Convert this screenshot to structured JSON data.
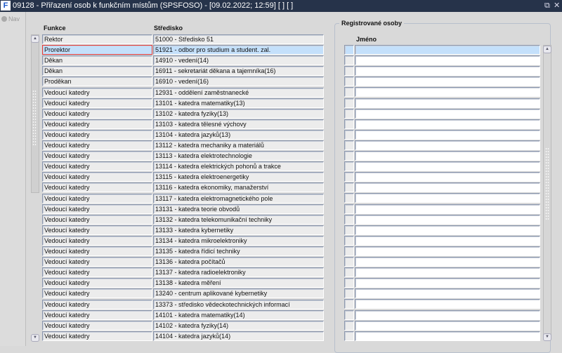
{
  "window": {
    "title": "09128 - Přiřazení osob k funkčním místům (SPSFOSO) - [09.02.2022; 12:59]  [ ]  [ ]",
    "logo": "F",
    "restore_icon": "⧉",
    "close_icon": "✕"
  },
  "nav": {
    "label": "Nav"
  },
  "left_table": {
    "headers": {
      "funkce": "Funkce",
      "stredisko": "Středisko"
    },
    "selected_index": 1,
    "rows": [
      [
        "Rektor",
        "51000 - Středisko 51"
      ],
      [
        "Prorektor",
        "51921 - odbor pro studium a student. zal."
      ],
      [
        "Děkan",
        "14910 - vedení(14)"
      ],
      [
        "Děkan",
        "16911 - sekretariát děkana a tajemníka(16)"
      ],
      [
        "Proděkan",
        "16910 - vedení(16)"
      ],
      [
        "Vedoucí katedry",
        "12931 - oddělení zaměstnanecké"
      ],
      [
        "Vedoucí katedry",
        "13101 - katedra matematiky(13)"
      ],
      [
        "Vedoucí katedry",
        "13102 - katedra fyziky(13)"
      ],
      [
        "Vedoucí katedry",
        "13103 - katedra tělesné výchovy"
      ],
      [
        "Vedoucí katedry",
        "13104 - katedra jazyků(13)"
      ],
      [
        "Vedoucí katedry",
        "13112 - katedra mechaniky a materiálů"
      ],
      [
        "Vedoucí katedry",
        "13113 - katedra elektrotechnologie"
      ],
      [
        "Vedoucí katedry",
        "13114 - katedra elektrických pohonů a trakce"
      ],
      [
        "Vedoucí katedry",
        "13115 - katedra elektroenergetiky"
      ],
      [
        "Vedoucí katedry",
        "13116 - katedra ekonomiky, manažerství"
      ],
      [
        "Vedoucí katedry",
        "13117 - katedra elektromagnetického pole"
      ],
      [
        "Vedoucí katedry",
        "13131 - katedra teorie obvodů"
      ],
      [
        "Vedoucí katedry",
        "13132 - katedra telekomunikační techniky"
      ],
      [
        "Vedoucí katedry",
        "13133 - katedra kybernetiky"
      ],
      [
        "Vedoucí katedry",
        "13134 - katedra mikroelektroniky"
      ],
      [
        "Vedoucí katedry",
        "13135 - katedra řídicí techniky"
      ],
      [
        "Vedoucí katedry",
        "13136 - katedra počítačů"
      ],
      [
        "Vedoucí katedry",
        "13137 - katedra radioelektroniky"
      ],
      [
        "Vedoucí katedry",
        "13138 - katedra měření"
      ],
      [
        "Vedoucí katedry",
        "13240 - centrum aplikované kybernetiky"
      ],
      [
        "Vedoucí katedry",
        "13373 - středisko vědeckotechnických informací"
      ],
      [
        "Vedoucí katedry",
        "14101 - katedra matematiky(14)"
      ],
      [
        "Vedoucí katedry",
        "14102 - katedra fyziky(14)"
      ],
      [
        "Vedoucí katedry",
        "14104 - katedra jazyků(14)"
      ]
    ]
  },
  "registered": {
    "legend": "Registrované osoby",
    "header": "Jméno",
    "row_count": 28,
    "selected_index": 0
  },
  "scroll": {
    "up": "▲",
    "down": "▼"
  }
}
